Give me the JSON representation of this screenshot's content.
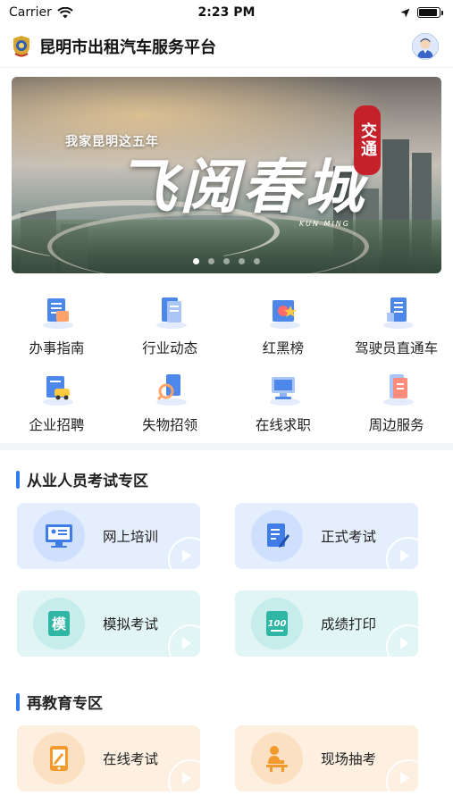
{
  "status_bar": {
    "carrier": "Carrier",
    "time": "2:23 PM"
  },
  "header": {
    "title": "昆明市出租汽车服务平台",
    "logo_icon": "badge-icon",
    "avatar_icon": "user-avatar-icon"
  },
  "banner": {
    "subtitle": "我家昆明这五年",
    "title": "飞阅春城",
    "seal": "交通",
    "en_text": "KUN MING",
    "active_slide": 1,
    "slide_count": 5
  },
  "quick_menu": {
    "items": [
      {
        "label": "办事指南",
        "icon": "guide-book-icon"
      },
      {
        "label": "行业动态",
        "icon": "news-icon"
      },
      {
        "label": "红黑榜",
        "icon": "ranking-icon"
      },
      {
        "label": "驾驶员直通车",
        "icon": "driver-channel-icon"
      },
      {
        "label": "企业招聘",
        "icon": "recruitment-icon"
      },
      {
        "label": "失物招领",
        "icon": "lost-found-icon"
      },
      {
        "label": "在线求职",
        "icon": "job-search-icon"
      },
      {
        "label": "周边服务",
        "icon": "nearby-service-icon"
      }
    ]
  },
  "exam_section": {
    "title": "从业人员考试专区",
    "cards": [
      {
        "label": "网上培训",
        "icon": "online-training-icon",
        "theme": "blue"
      },
      {
        "label": "正式考试",
        "icon": "formal-exam-icon",
        "theme": "blue"
      },
      {
        "label": "模拟考试",
        "icon": "mock-exam-icon",
        "icon_text": "模",
        "theme": "teal"
      },
      {
        "label": "成绩打印",
        "icon": "score-print-icon",
        "icon_text": "100",
        "theme": "teal"
      }
    ]
  },
  "education_section": {
    "title": "再教育专区",
    "cards": [
      {
        "label": "在线考试",
        "icon": "online-exam-icon",
        "theme": "orange"
      },
      {
        "label": "现场抽考",
        "icon": "onsite-exam-icon",
        "theme": "orange"
      }
    ]
  },
  "colors": {
    "accent": "#2f7bf0",
    "blue_card": "#e5eefd",
    "teal_card": "#e1f5f5",
    "orange_card": "#fdf0e1",
    "teal_icon": "#2fb6a5",
    "orange_icon": "#f29a2e"
  }
}
